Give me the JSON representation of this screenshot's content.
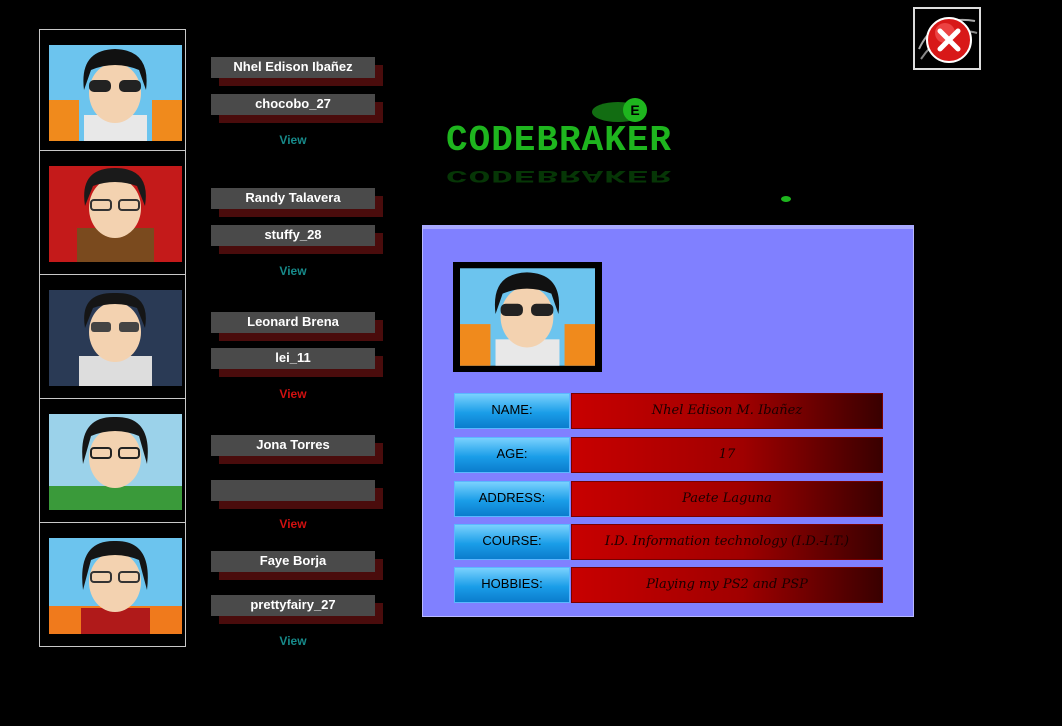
{
  "window": {
    "close_icon": "close-icon"
  },
  "logo": {
    "text": "CODEBRAKER",
    "accent_letter": "E",
    "color": "#1eb51e"
  },
  "members": [
    {
      "name": "Nhel Edison Ibañez",
      "username": "chocobo_27",
      "view_label": "View",
      "view_color": "teal"
    },
    {
      "name": "Randy Talavera",
      "username": "stuffy_28",
      "view_label": "View",
      "view_color": "teal"
    },
    {
      "name": "Leonard Brena",
      "username": "lei_11",
      "view_label": "View",
      "view_color": "red"
    },
    {
      "name": "Jona Torres",
      "username": "",
      "view_label": "View",
      "view_color": "red"
    },
    {
      "name": "Faye Borja",
      "username": "prettyfairy_27",
      "view_label": "View",
      "view_color": "teal"
    }
  ],
  "profile": {
    "fields": [
      {
        "label": "NAME:",
        "value": "Nhel Edison M. Ibañez"
      },
      {
        "label": "AGE:",
        "value": "17"
      },
      {
        "label": "ADDRESS:",
        "value": "Paete Laguna"
      },
      {
        "label": "COURSE:",
        "value": "I.D. Information technology (I.D.-I.T.)"
      },
      {
        "label": "HOBBIES:",
        "value": "Playing my PS2 and PSP"
      }
    ]
  },
  "colors": {
    "panel_bg": "#8080ff",
    "label_blue": "#1a9de8",
    "value_red": "#c80000"
  }
}
